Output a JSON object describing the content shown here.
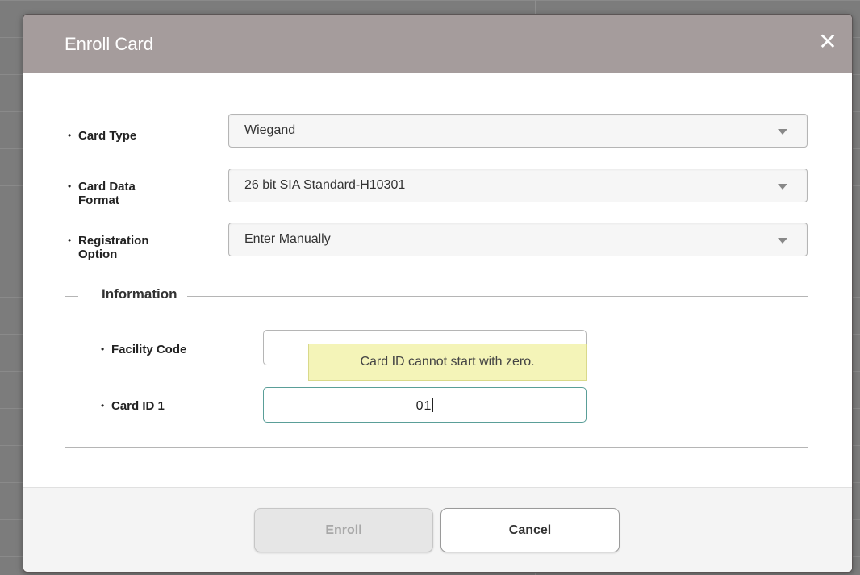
{
  "dialog": {
    "title": "Enroll Card",
    "close_symbol": "✕"
  },
  "fields": {
    "card_type": {
      "label": "Card Type",
      "value": "Wiegand"
    },
    "card_data_format": {
      "label_line1": "Card Data",
      "label_line2": "Format",
      "value": "26 bit SIA Standard-H10301"
    },
    "registration_option": {
      "label_line1": "Registration",
      "label_line2": "Option",
      "value": "Enter Manually"
    }
  },
  "information": {
    "legend": "Information",
    "facility_code": {
      "label": "Facility Code",
      "value": ""
    },
    "card_id_1": {
      "label": "Card ID 1",
      "value": "01"
    },
    "tooltip": "Card ID cannot start with zero."
  },
  "footer": {
    "enroll_label": "Enroll",
    "cancel_label": "Cancel"
  },
  "colors": {
    "header_bg": "#a59c9c",
    "tooltip_bg": "#f4f4b8",
    "focus_border": "#5a9e98"
  },
  "icons": [
    "close-icon",
    "dropdown-caret-icon",
    "bullet-dot-icon"
  ]
}
